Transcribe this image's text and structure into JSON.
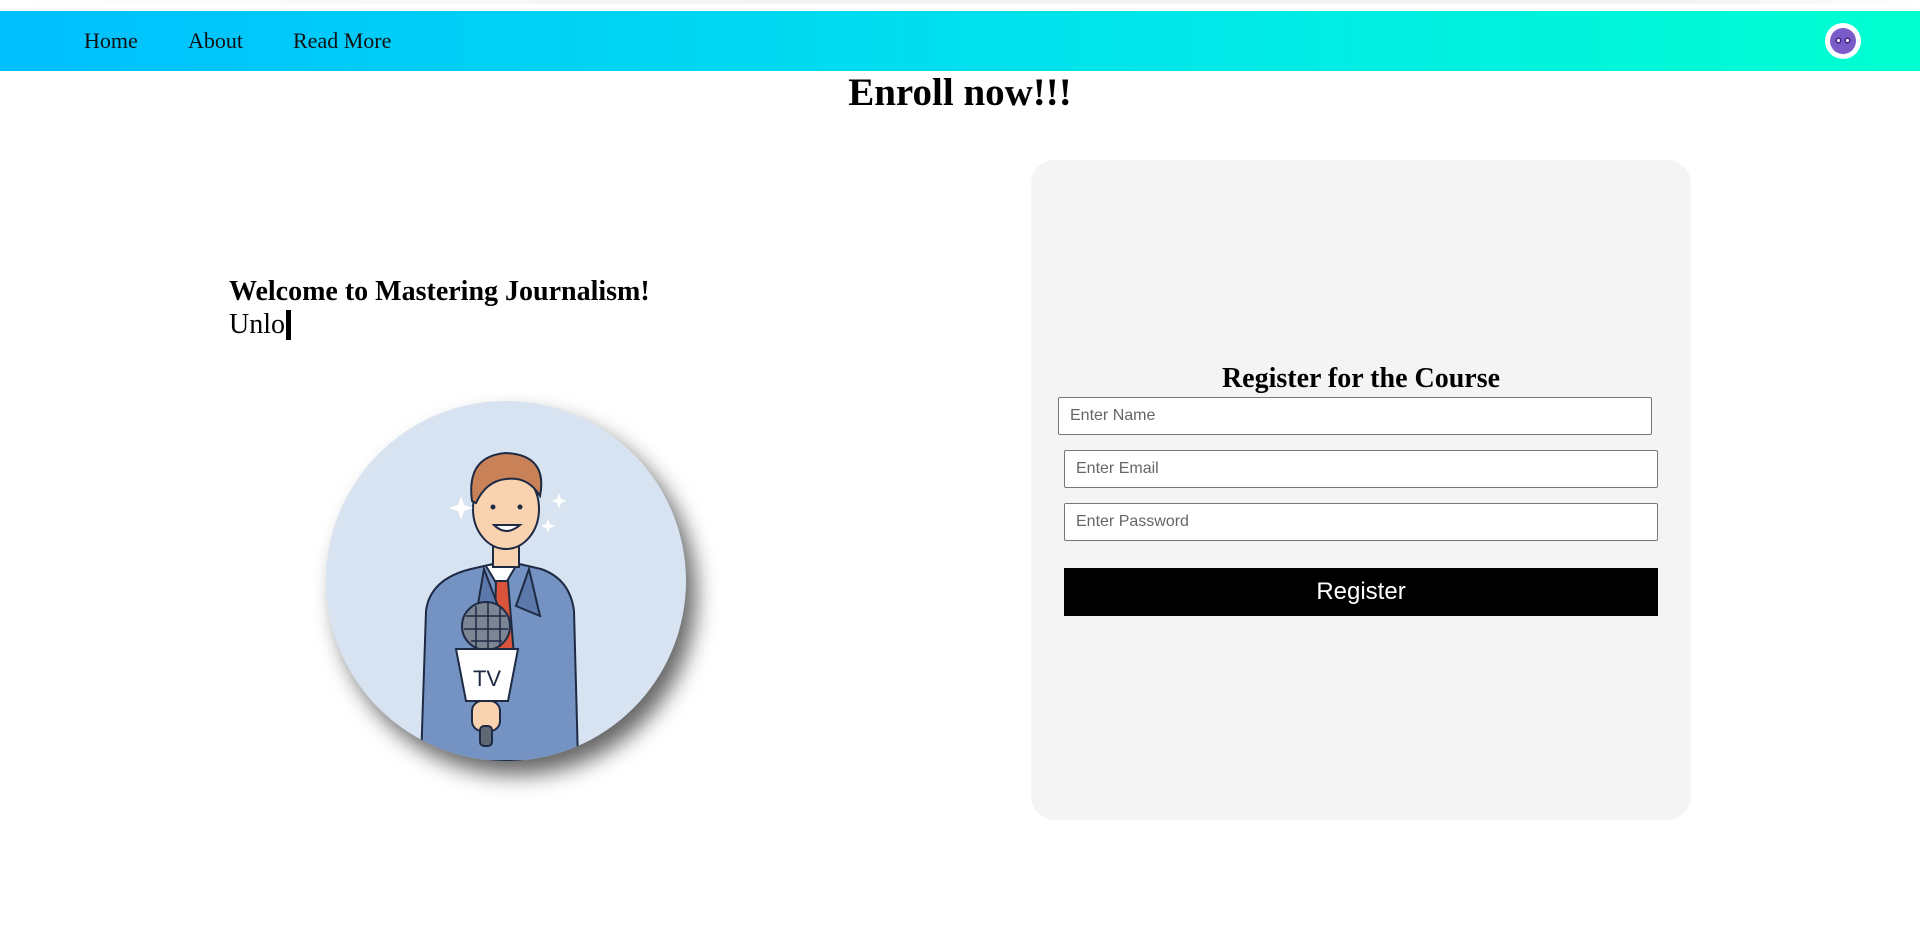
{
  "nav": {
    "links": [
      {
        "label": "Home"
      },
      {
        "label": "About"
      },
      {
        "label": "Read More"
      }
    ],
    "avatar_icon": "owl-avatar-icon"
  },
  "hero": {
    "headline": "Enroll now!!!",
    "welcome": "Welcome to Mastering Journalism!",
    "typed_text": "Unlo",
    "illustration_caption": "TV",
    "illustration_subject": "journalist-with-tv-microphone"
  },
  "form": {
    "title": "Register for the Course",
    "name_placeholder": "Enter Name",
    "email_placeholder": "Enter Email",
    "password_placeholder": "Enter Password",
    "submit_label": "Register"
  },
  "colors": {
    "nav_gradient_start": "#00bfff",
    "nav_gradient_end": "#00ffd0",
    "card_background": "#f4f4f4",
    "button_background": "#000000",
    "button_text": "#ffffff"
  }
}
